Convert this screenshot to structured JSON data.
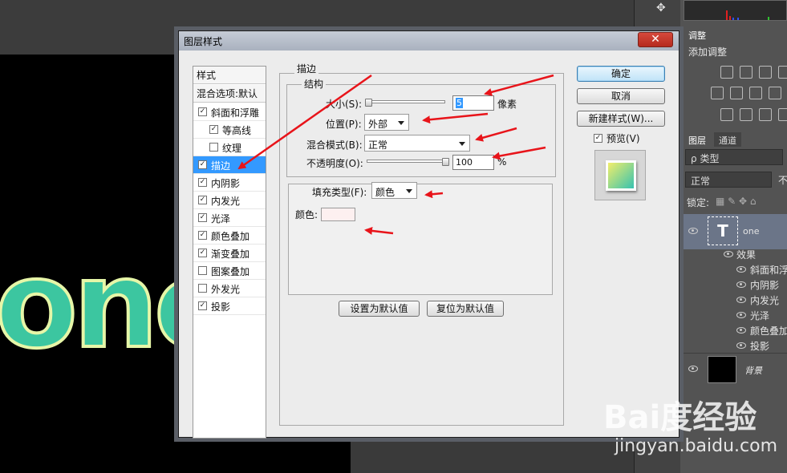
{
  "canvas": {
    "text": "one"
  },
  "dialog": {
    "title": "图层样式",
    "close_symbol": "✕",
    "style_list": {
      "header": "样式",
      "blend_options": "混合选项:默认",
      "items": [
        {
          "label": "斜面和浮雕",
          "checked": true,
          "indent": false
        },
        {
          "label": "等高线",
          "checked": true,
          "indent": true
        },
        {
          "label": "纹理",
          "checked": false,
          "indent": true
        },
        {
          "label": "描边",
          "checked": true,
          "indent": false,
          "selected": true
        },
        {
          "label": "内阴影",
          "checked": true,
          "indent": false
        },
        {
          "label": "内发光",
          "checked": true,
          "indent": false
        },
        {
          "label": "光泽",
          "checked": true,
          "indent": false
        },
        {
          "label": "颜色叠加",
          "checked": true,
          "indent": false
        },
        {
          "label": "渐变叠加",
          "checked": true,
          "indent": false
        },
        {
          "label": "图案叠加",
          "checked": false,
          "indent": false
        },
        {
          "label": "外发光",
          "checked": false,
          "indent": false
        },
        {
          "label": "投影",
          "checked": true,
          "indent": false
        }
      ]
    },
    "stroke": {
      "section_title": "描边",
      "structure_title": "结构",
      "size_label": "大小(S):",
      "size_value": "5",
      "size_unit": "像素",
      "position_label": "位置(P):",
      "position_value": "外部",
      "blend_label": "混合模式(B):",
      "blend_value": "正常",
      "opacity_label": "不透明度(O):",
      "opacity_value": "100",
      "opacity_unit": "%",
      "fill_type_label": "填充类型(F):",
      "fill_type_value": "颜色",
      "color_label": "颜色:",
      "color_value": "#fdf0f0",
      "set_default": "设置为默认值",
      "reset_default": "复位为默认值"
    },
    "buttons": {
      "ok": "确定",
      "cancel": "取消",
      "new_style": "新建样式(W)...",
      "preview_label": "预览(V)",
      "preview_checked": true
    }
  },
  "panels": {
    "adjust_tab": "调整",
    "adjust_hint": "添加调整",
    "layers_tab": "图层",
    "channels_tab": "通道",
    "filter_kind": "类型",
    "blend_mode": "正常",
    "opacity_trunc": "不",
    "lock_label": "锁定:",
    "layer_one": {
      "thumb": "T",
      "name": "one"
    },
    "effects_label": "效果",
    "effects": [
      "斜面和浮",
      "内阴影",
      "内发光",
      "光泽",
      "颜色叠加",
      "投影"
    ],
    "background": {
      "name": "背景"
    }
  },
  "watermark": {
    "logo": "Bai度经验",
    "url": "jingyan.baidu.com"
  },
  "colors": {
    "accent_selected": "#3399ff",
    "arrow": "#e8141a",
    "canvas_text": "#3cc6a0"
  }
}
